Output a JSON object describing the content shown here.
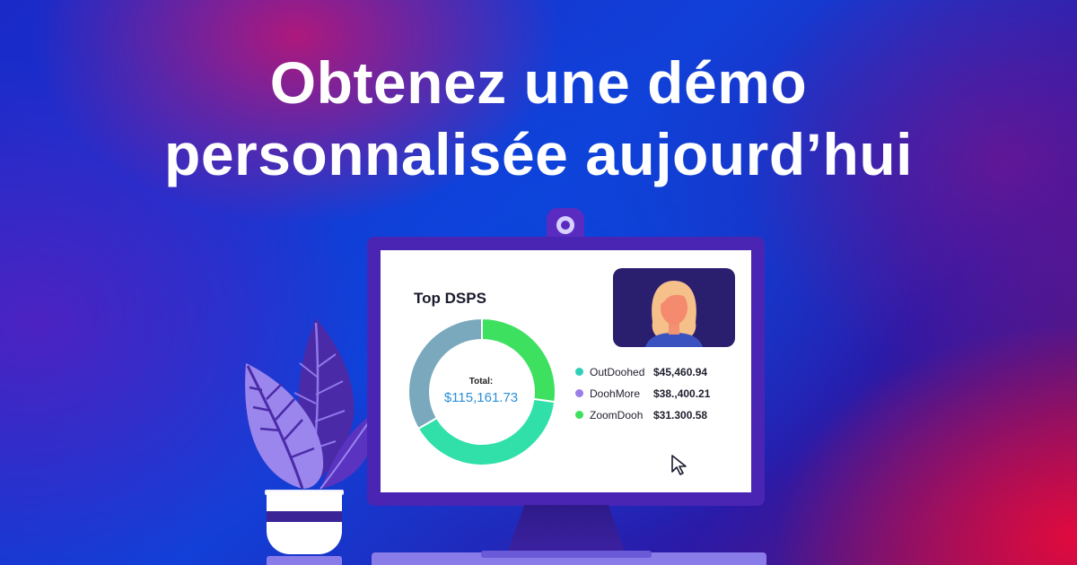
{
  "headline": {
    "line1": "Obtenez une démo",
    "line2": "personnalisée aujourd’hui"
  },
  "dashboard": {
    "title": "Top DSPS",
    "total_label": "Total:",
    "total_value": "$115,161.73"
  },
  "chart_data": {
    "type": "pie",
    "title": "Top DSPS",
    "categories": [
      "OutDoohed",
      "DoohMore",
      "ZoomDooh"
    ],
    "values": [
      45460.94,
      38400.21,
      31300.58
    ],
    "value_labels": [
      "$45,460.94",
      "$38.,400.21",
      "$31.300.58"
    ],
    "total": "$115,161.73",
    "colors": [
      "#30e0a8",
      "#7aa8bc",
      "#3ee060"
    ],
    "legend_position": "right"
  },
  "legend": [
    {
      "name": "OutDoohed",
      "value": "$45,460.94",
      "color": "#30d0b8"
    },
    {
      "name": "DoohMore",
      "value": "$38.,400.21",
      "color": "#9a7ee8"
    },
    {
      "name": "ZoomDooh",
      "value": "$31.300.58",
      "color": "#3ee060"
    }
  ],
  "colors": {
    "monitor": "#4a25b4",
    "accent_blue": "#2b8fd8"
  },
  "icons": {
    "webcam": "webcam-icon",
    "cursor": "cursor-arrow-icon",
    "avatar": "person-avatar-icon",
    "plant": "plant-icon"
  }
}
